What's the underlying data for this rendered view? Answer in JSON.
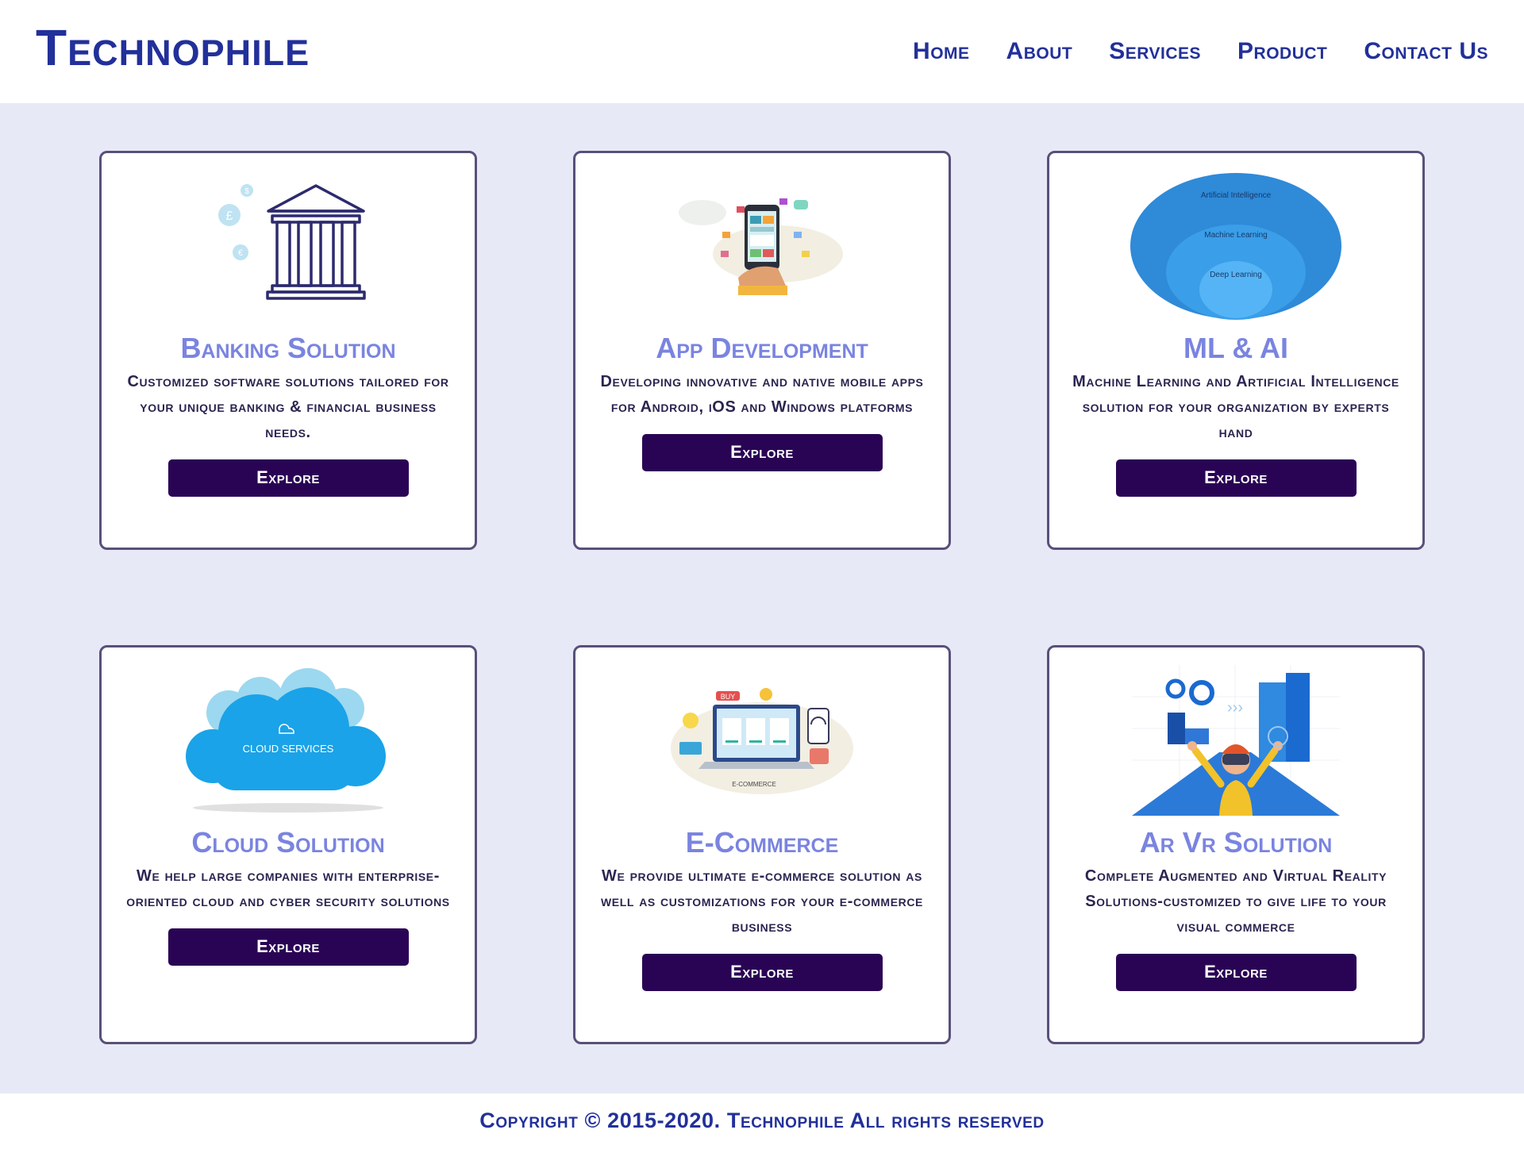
{
  "header": {
    "brand": "Technophile",
    "nav": [
      "Home",
      "About",
      "Services",
      "Product",
      "Contact Us"
    ]
  },
  "cards": [
    {
      "title": "Banking Solution",
      "description": "Customized software solutions tailored for your unique banking & financial business needs.",
      "button": "Explore",
      "icon": "bank-building-icon"
    },
    {
      "title": "App Development",
      "description": "Developing innovative and native mobile apps for Android, iOS and Windows platforms",
      "button": "Explore",
      "icon": "smartphone-apps-icon"
    },
    {
      "title": "ML & AI",
      "description": "Machine Learning and Artificial Intelligence solution for your organization by experts hand",
      "button": "Explore",
      "icon": "ai-ml-dl-diagram",
      "image_labels": [
        "Artificial Intelligence",
        "Machine Learning",
        "Deep Learning"
      ]
    },
    {
      "title": "Cloud Solution",
      "description": "We help large companies with enterprise-oriented cloud and cyber security solutions",
      "button": "Explore",
      "icon": "cloud-services-icon",
      "image_label": "CLOUD SERVICES"
    },
    {
      "title": "E-Commerce",
      "description": "We provide ultimate e-commerce solution as well as customizations for your e-commerce business",
      "button": "Explore",
      "icon": "ecommerce-laptop-icon",
      "image_labels": [
        "BUY",
        "E-COMMERCE"
      ]
    },
    {
      "title": "Ar Vr Solution",
      "description": "Complete Augmented and Virtual Reality Solutions-customized to give life to your visual commerce",
      "button": "Explore",
      "icon": "vr-headset-person-icon"
    }
  ],
  "footer": {
    "copyright": "Copyright © 2015-2020. Technophile All rights reserved"
  },
  "colors": {
    "brand": "#22309a",
    "card_title": "#7a84e0",
    "button_bg": "#2a0454",
    "page_bg": "#e8e9f6",
    "card_border": "#58507a"
  }
}
